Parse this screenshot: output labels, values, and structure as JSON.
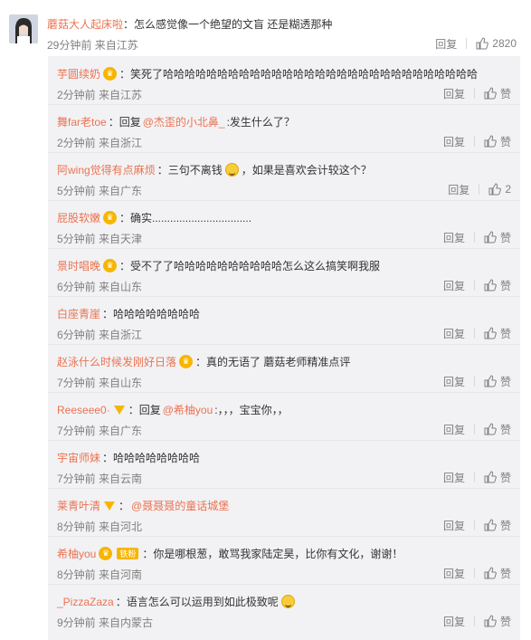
{
  "main_comment": {
    "user": "蘑菇大人起床啦",
    "text": "：怎么感觉像一个绝望的文盲 还是糊透那种",
    "time": "29分钟前",
    "source": "来自江苏",
    "reply_label": "回复",
    "like_count": "2820"
  },
  "replies": [
    {
      "user": "芋圆续奶",
      "badge": "crown",
      "text": "：笑死了哈哈哈哈哈哈哈哈哈哈哈哈哈哈哈哈哈哈哈哈哈哈哈哈哈哈哈哈哈",
      "time": "2分钟前",
      "source": "来自江苏",
      "reply_label": "回复",
      "like_label": "赞"
    },
    {
      "user": "舞far老toe",
      "text_before": "：回复",
      "mention": "@杰歪的小北鼻_",
      "text": ":发生什么了？",
      "time": "2分钟前",
      "source": "来自浙江",
      "reply_label": "回复",
      "like_label": "赞"
    },
    {
      "user": "阿wing觉得有点麻烦",
      "text": "：三句不离钱",
      "emoji": "laugh-emoji",
      "text_after": "，如果是喜欢会计较这个？",
      "time": "5分钟前",
      "source": "来自广东",
      "reply_label": "回复",
      "like_label": "2"
    },
    {
      "user": "屁股软嫩",
      "badge": "crown",
      "text": "：确实.................................",
      "time": "5分钟前",
      "source": "来自天津",
      "reply_label": "回复",
      "like_label": "赞"
    },
    {
      "user": "景时唱晚",
      "badge": "crown",
      "text": "：受不了了哈哈哈哈哈哈哈哈哈哈怎么这么搞笑啊我服",
      "time": "6分钟前",
      "source": "来自山东",
      "reply_label": "回复",
      "like_label": "赞"
    },
    {
      "user": "白座青崖",
      "text": "：哈哈哈哈哈哈哈哈",
      "time": "6分钟前",
      "source": "来自浙江",
      "reply_label": "回复",
      "like_label": "赞"
    },
    {
      "user": "赵泳什么时候发刚好日落",
      "badge": "crown",
      "text": "：真的无语了 蘑菇老师精准点评",
      "time": "7分钟前",
      "source": "来自山东",
      "reply_label": "回复",
      "like_label": "赞"
    },
    {
      "user": "Reeseee0·",
      "badge": "v",
      "text_before": "：回复",
      "mention": "@希柚you",
      "text": ":，，，宝宝你，，",
      "time": "7分钟前",
      "source": "来自广东",
      "reply_label": "回复",
      "like_label": "赞"
    },
    {
      "user": "宇宙师妹",
      "text": "：哈哈哈哈哈哈哈哈",
      "time": "7分钟前",
      "source": "来自云南",
      "reply_label": "回复",
      "like_label": "赞"
    },
    {
      "user": "莱青叶清",
      "badge": "v",
      "text_before": "：",
      "mention": "@聂聂聂的童话城堡",
      "text": "",
      "time": "8分钟前",
      "source": "来自河北",
      "reply_label": "回复",
      "like_label": "赞"
    },
    {
      "user": "希柚you",
      "badge": "crown",
      "fan_badge": "铁粉",
      "text": "：你是哪根葱，敢骂我家陆定昊，比你有文化，谢谢！",
      "time": "8分钟前",
      "source": "来自河南",
      "reply_label": "回复",
      "like_label": "赞"
    },
    {
      "user": "_PizzaZaza",
      "text": "：语言怎么可以运用到如此极致呢",
      "emoji": "laugh-emoji",
      "time": "9分钟前",
      "source": "来自内蒙古",
      "reply_label": "回复",
      "like_label": "赞"
    }
  ]
}
